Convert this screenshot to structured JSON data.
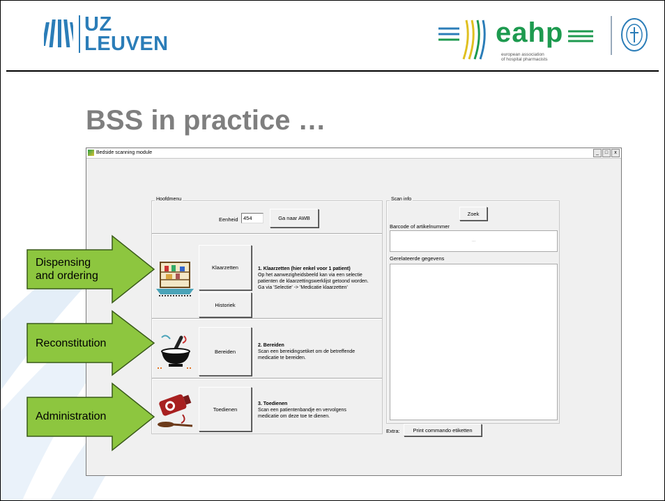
{
  "header": {
    "uz_logo": {
      "line1": "UZ",
      "line2": "LEUVEN"
    },
    "eahp_logo": {
      "word": "eahp",
      "sub1": "european association",
      "sub2": "of hospital pharmacists"
    }
  },
  "slide_title": "BSS in practice …",
  "window": {
    "title": "Bedside scanning module",
    "controls": [
      "_",
      "□",
      "x"
    ],
    "hoofdmenu": {
      "legend": "Hoofdmenu",
      "eenheid_label": "Eenheid",
      "eenheid_value": "454",
      "ga_naar_awb": "Ga naar AWB",
      "sections": [
        {
          "button": "Klaarzetten",
          "extra_button": "Historiek",
          "title": "1. Klaarzetten (hier enkel voor 1 patient)",
          "lines": [
            "Op het aanwezigheidsbeeld kan via een selectie",
            "patienten de klaarzettingswerklijst getoond worden.",
            "Ga via 'Selectie' -> 'Medicatie klaarzetten'"
          ]
        },
        {
          "button": "Bereiden",
          "title": "2. Bereiden",
          "lines": [
            "Scan een bereidingsetiket om de betreffende",
            "medicatie te bereiden."
          ]
        },
        {
          "button": "Toedienen",
          "title": "3. Toedienen",
          "lines": [
            "Scan een patientenbandje en vervolgens",
            "medicatie om deze toe te dienen."
          ]
        }
      ]
    },
    "scan_info": {
      "legend": "Scan info",
      "zoek": "Zoek",
      "barcode_label": "Barcode of artikelnummer",
      "barcode_value": "...",
      "related_label": "Gerelateerde gegevens"
    },
    "extra_label": "Extra:",
    "print_button": "Print commando etiketten"
  },
  "arrows": [
    {
      "label_line1": "Dispensing",
      "label_line2": "and ordering"
    },
    {
      "label_line1": "Reconstitution",
      "label_line2": ""
    },
    {
      "label_line1": "Administration",
      "label_line2": ""
    }
  ],
  "colors": {
    "arrow_fill": "#8dc63f",
    "uz_blue": "#2b7db8",
    "eahp_green": "#1d9a4f",
    "title_gray": "#7f7f7f"
  }
}
